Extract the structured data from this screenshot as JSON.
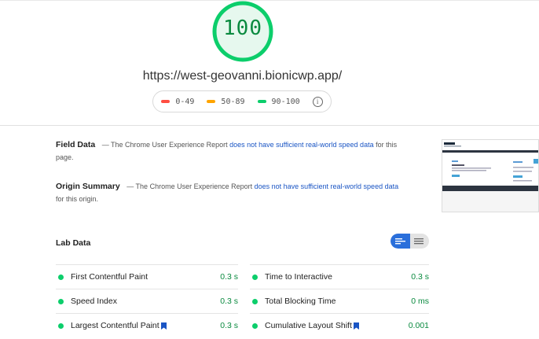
{
  "score": {
    "value": "100",
    "color": "#0cce6b"
  },
  "page_url": "https://west-geovanni.bionicwp.app/",
  "legend": [
    {
      "range": "0-49",
      "color": "#ff4e42"
    },
    {
      "range": "50-89",
      "color": "#ffa400"
    },
    {
      "range": "90-100",
      "color": "#0cce6b"
    }
  ],
  "field_data": {
    "heading": "Field Data",
    "text_before": "— The Chrome User Experience Report",
    "link": "does not have sufficient real-world speed data",
    "text_after": "for this page."
  },
  "origin_summary": {
    "heading": "Origin Summary",
    "text_before": "— The Chrome User Experience Report",
    "link": "does not have sufficient real-world speed data",
    "text_after": "for this origin."
  },
  "lab_data": {
    "heading": "Lab Data",
    "metrics": [
      {
        "label": "First Contentful Paint",
        "value": "0.3 s"
      },
      {
        "label": "Time to Interactive",
        "value": "0.3 s"
      },
      {
        "label": "Speed Index",
        "value": "0.3 s"
      },
      {
        "label": "Total Blocking Time",
        "value": "0 ms"
      },
      {
        "label": "Largest Contentful Paint",
        "value": "0.3 s"
      },
      {
        "label": "Cumulative Layout Shift",
        "value": "0.001"
      }
    ]
  },
  "icons": {
    "info": "info-circle-icon",
    "bookmark": "bookmark-icon",
    "view_list": "list-view-icon",
    "view_text": "text-view-icon"
  }
}
